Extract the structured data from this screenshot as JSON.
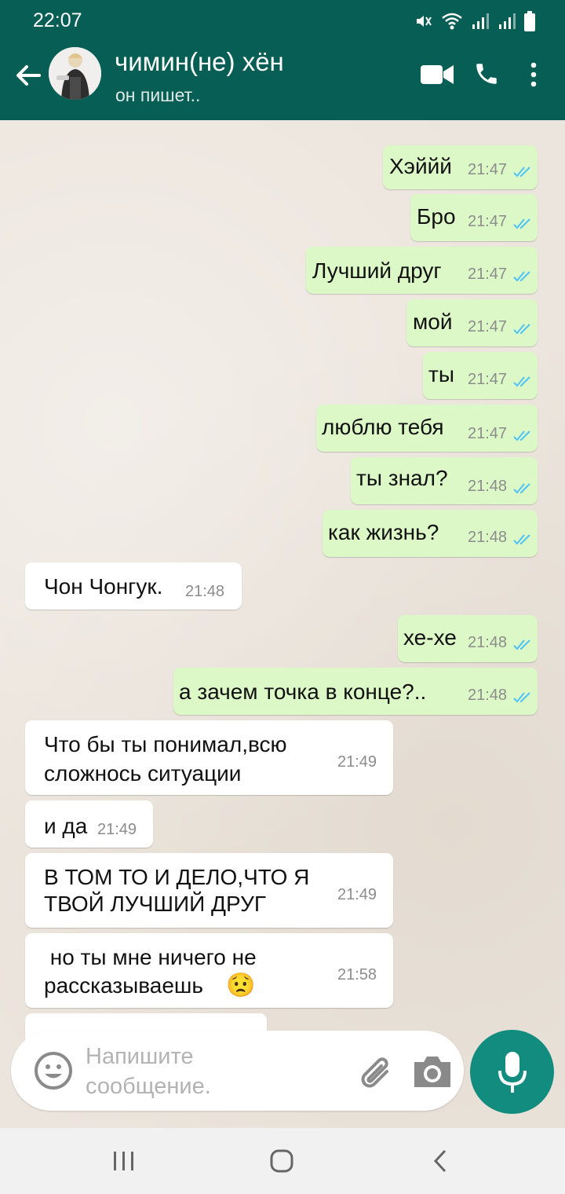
{
  "status_bar": {
    "time": "22:07"
  },
  "header": {
    "contact_name": "чимин(не) хён",
    "contact_status": "он пишет.."
  },
  "messages": [
    {
      "direction": "out",
      "text": "Хэййй",
      "time": "21:47",
      "read": true
    },
    {
      "direction": "out",
      "text": "Бро",
      "time": "21:47",
      "read": true
    },
    {
      "direction": "out",
      "text": "Лучший друг",
      "time": "21:47",
      "read": true
    },
    {
      "direction": "out",
      "text": "мой",
      "time": "21:47",
      "read": true
    },
    {
      "direction": "out",
      "text": "ты",
      "time": "21:47",
      "read": true
    },
    {
      "direction": "out",
      "text": "люблю тебя",
      "time": "21:47",
      "read": true
    },
    {
      "direction": "out",
      "text": "ты знал?",
      "time": "21:48",
      "read": true
    },
    {
      "direction": "out",
      "text": "как жизнь?",
      "time": "21:48",
      "read": true
    },
    {
      "direction": "in",
      "text": "Чон Чонгук.",
      "time": "21:48"
    },
    {
      "direction": "out",
      "text": "хе-хе",
      "time": "21:48",
      "read": true
    },
    {
      "direction": "out",
      "text": "а зачем точка в конце?..",
      "time": "21:48",
      "read": true
    },
    {
      "direction": "in",
      "lines": [
        "Что бы ты понимал,всю",
        "сложнось ситуации"
      ],
      "time": "21:49"
    },
    {
      "direction": "in",
      "text": "и да",
      "time": "21:49"
    },
    {
      "direction": "in",
      "lines": [
        "В ТОМ ТО И ДЕЛО,ЧТО Я",
        "ТВОЙ ЛУЧШИЙ ДРУГ"
      ],
      "time": "21:49"
    },
    {
      "direction": "in",
      "lines": [
        " но ты мне ничего не",
        "рассказываешь"
      ],
      "emoji": "😟",
      "time": "21:58"
    }
  ],
  "composer": {
    "placeholder": "Напишите\nсообщение."
  },
  "colors": {
    "header": "#075e54",
    "outgoing_bubble": "#dcf8c6",
    "incoming_bubble": "#ffffff",
    "read_ticks": "#4fc3f7",
    "mic_button": "#128c7e"
  }
}
